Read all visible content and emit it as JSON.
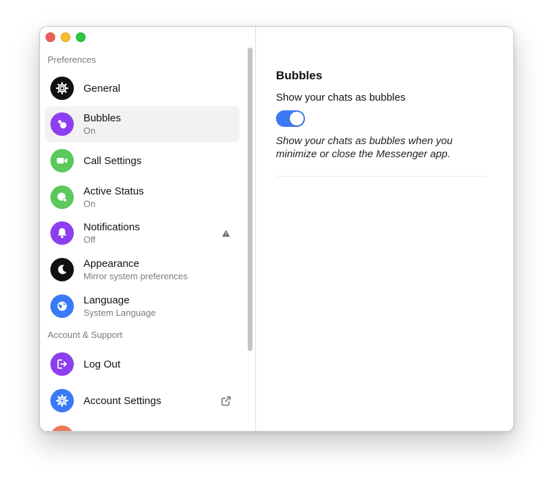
{
  "sidebar": {
    "sections": [
      {
        "label": "Preferences"
      },
      {
        "label": "Account & Support"
      }
    ],
    "items": [
      {
        "label": "General",
        "sub": "",
        "icon": "gear-icon",
        "color": "#111111"
      },
      {
        "label": "Bubbles",
        "sub": "On",
        "icon": "bubbles-icon",
        "color": "#8d3ff0"
      },
      {
        "label": "Call Settings",
        "sub": "",
        "icon": "video-camera-icon",
        "color": "#5ac85a"
      },
      {
        "label": "Active Status",
        "sub": "On",
        "icon": "active-status-icon",
        "color": "#5ac85a"
      },
      {
        "label": "Notifications",
        "sub": "Off",
        "icon": "bell-icon",
        "color": "#8d3ff0"
      },
      {
        "label": "Appearance",
        "sub": "Mirror system preferences",
        "icon": "moon-icon",
        "color": "#111111"
      },
      {
        "label": "Language",
        "sub": "System Language",
        "icon": "globe-icon",
        "color": "#3b7af5"
      },
      {
        "label": "Log Out",
        "sub": "",
        "icon": "logout-icon",
        "color": "#8d3ff0"
      },
      {
        "label": "Account Settings",
        "sub": "",
        "icon": "gear-icon",
        "color": "#3b7af5"
      }
    ],
    "selected": "Bubbles"
  },
  "content": {
    "title": "Bubbles",
    "setting_label": "Show your chats as bubbles",
    "toggle_on": true,
    "description": "Show your chats as bubbles when you minimize or close the Messenger app."
  },
  "colors": {
    "accent": "#3b7af5",
    "purple": "#8d3ff0",
    "green": "#5ac85a",
    "partial_icon": "#ee7a5a"
  }
}
